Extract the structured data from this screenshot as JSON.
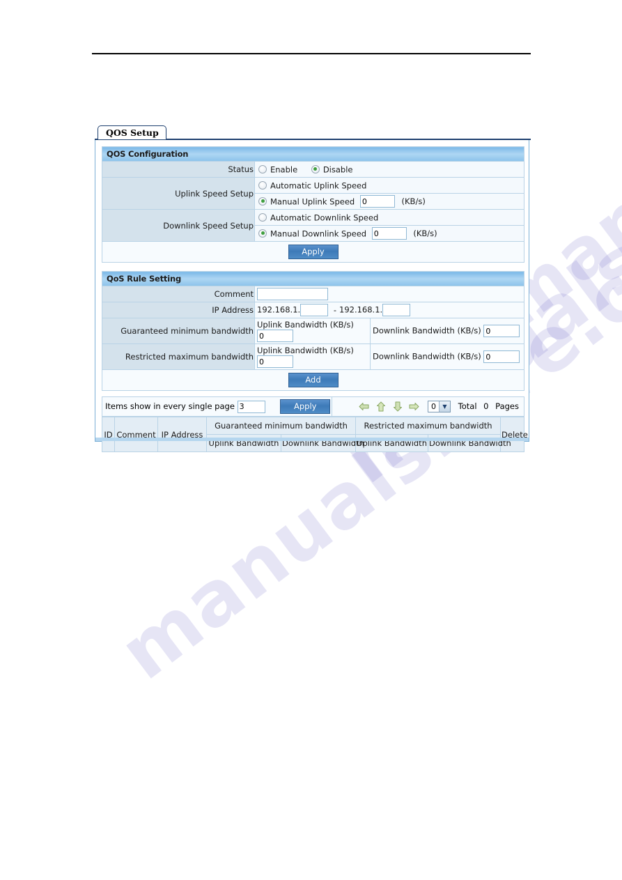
{
  "watermark": {
    "text": "manualshive.com"
  },
  "tab": {
    "label": "QOS Setup"
  },
  "config": {
    "title": "QOS Configuration",
    "status": {
      "label": "Status",
      "enable_label": "Enable",
      "disable_label": "Disable",
      "selected": "Disable"
    },
    "uplink": {
      "label": "Uplink Speed Setup",
      "auto_label": "Automatic Uplink Speed",
      "manual_label": "Manual Uplink Speed",
      "manual_value": "0",
      "unit": "(KB/s)",
      "selected": "Manual Uplink Speed"
    },
    "downlink": {
      "label": "Downlink Speed Setup",
      "auto_label": "Automatic Downlink Speed",
      "manual_label": "Manual Downlink Speed",
      "manual_value": "0",
      "unit": "(KB/s)",
      "selected": "Manual Downlink Speed"
    },
    "apply_label": "Apply"
  },
  "rule": {
    "title": "QoS Rule Setting",
    "comment": {
      "label": "Comment",
      "value": ""
    },
    "ip_address": {
      "label": "IP Address",
      "prefix_start": "192.168.1.",
      "start_value": "",
      "separator": "-",
      "prefix_end": "192.168.1.",
      "end_value": ""
    },
    "guaranteed": {
      "label": "Guaranteed minimum bandwidth",
      "uplink_label": "Uplink Bandwidth (KB/s)",
      "uplink_value": "0",
      "downlink_label": "Downlink Bandwidth (KB/s)",
      "downlink_value": "0"
    },
    "restricted": {
      "label": "Restricted maximum bandwidth",
      "uplink_label": "Uplink Bandwidth (KB/s)",
      "uplink_value": "0",
      "downlink_label": "Downlink Bandwidth (KB/s)",
      "downlink_value": "0"
    },
    "add_label": "Add"
  },
  "paging": {
    "items_label": "Items show in every single page",
    "items_value": "3",
    "apply_label": "Apply",
    "page_select_value": "0",
    "total_label": "Total",
    "total_pages": "0",
    "pages_label": "Pages",
    "icons": {
      "prev": "arrow-left-icon",
      "first": "arrow-up-icon",
      "last": "arrow-down-icon",
      "next": "arrow-right-icon"
    }
  },
  "grid": {
    "headers": {
      "id": "ID",
      "comment": "Comment",
      "ip_address": "IP Address",
      "guaranteed_group": "Guaranteed minimum bandwidth",
      "restricted_group": "Restricted maximum bandwidth",
      "guaranteed_uplink": "Uplink Bandwidth",
      "guaranteed_downlink": "Downlink Bandwidth",
      "restricted_uplink": "Uplink Bandwidth",
      "restricted_downlink": "Downlink Bandwidth",
      "delete": "Delete"
    },
    "rows": []
  },
  "colors": {
    "section_bar": "#8cc3ea",
    "label_cell": "#d4e2ec",
    "button_blue": "#3d7ab8",
    "radio_dot_green": "#3d9e3d",
    "panel_border": "#7aafd6",
    "grid_cell": "#e3edf5"
  }
}
